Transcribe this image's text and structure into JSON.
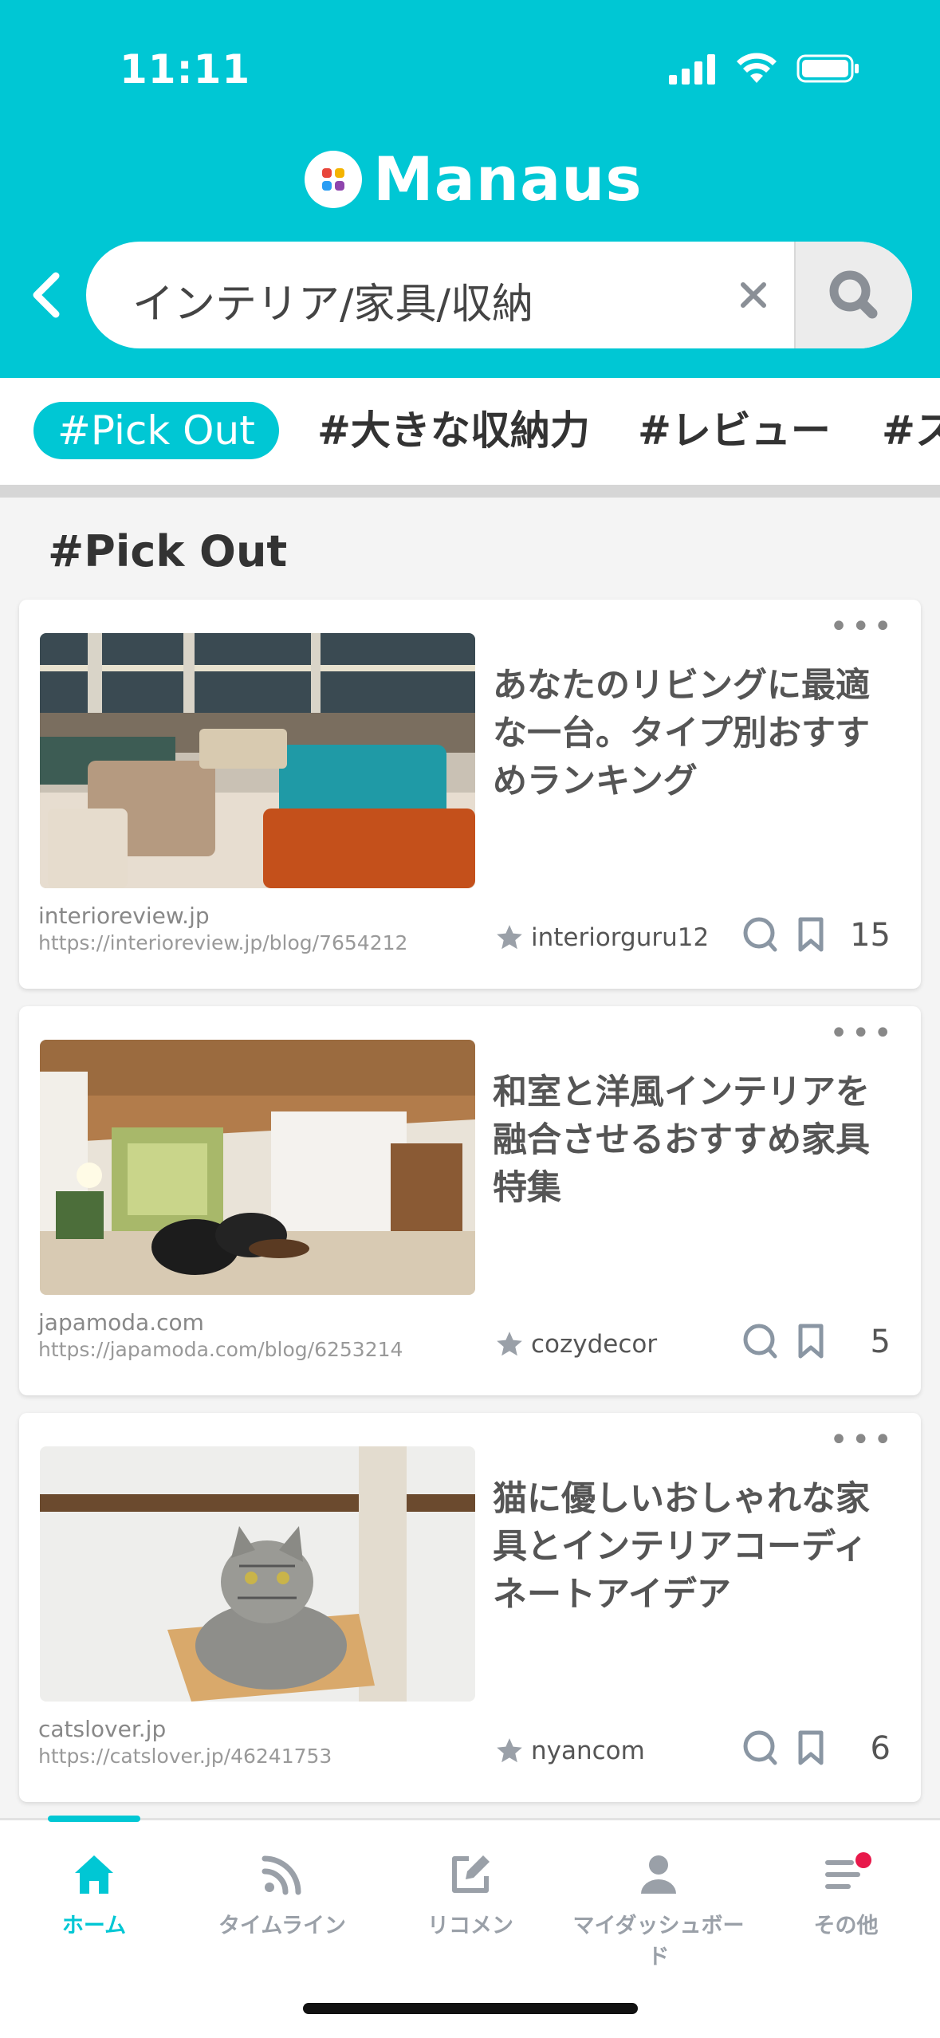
{
  "status": {
    "time": "11:11"
  },
  "header": {
    "logo_text": "Manaus",
    "search_value": "インテリア/家具/収納",
    "colors": {
      "brand": "#00c7d4"
    }
  },
  "tags": [
    "#Pick Out",
    "#大きな収納力",
    "#レビュー",
    "#ス"
  ],
  "section_title": "#Pick Out",
  "cards": [
    {
      "title": "あなたのリビングに最適な一台。タイプ別おすすめランキング",
      "domain": "interioreview.jp",
      "url": "https://interioreview.jp/blog/7654212",
      "user": "interiorguru12",
      "count": "15"
    },
    {
      "title": "和室と洋風インテリアを融合させるおすすめ家具特集",
      "domain": "japamoda.com",
      "url": "https://japamoda.com/blog/6253214",
      "user": "cozydecor",
      "count": "5"
    },
    {
      "title": "猫に優しいおしゃれな家具とインテリアコーディネートアイデア",
      "domain": "catslover.jp",
      "url": "https://catslover.jp/46241753",
      "user": "nyancom",
      "count": "6"
    }
  ],
  "nav": [
    {
      "label": "ホーム",
      "icon": "home-icon"
    },
    {
      "label": "タイムライン",
      "icon": "rss-icon"
    },
    {
      "label": "リコメン",
      "icon": "edit-icon"
    },
    {
      "label": "マイダッシュボード",
      "icon": "user-icon"
    },
    {
      "label": "その他",
      "icon": "menu-icon"
    }
  ]
}
